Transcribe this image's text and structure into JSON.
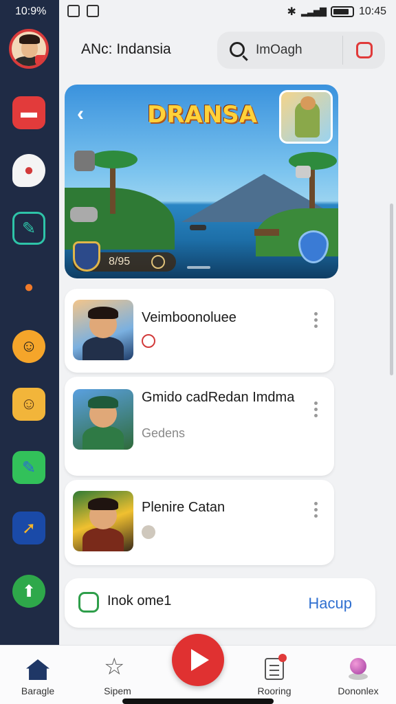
{
  "status_bar": {
    "time_left": "10:9%",
    "time_right": "10:45"
  },
  "header": {
    "title": "ANc: Indansia",
    "search_placeholder": "ImOagh"
  },
  "banner": {
    "title": "DRANSA",
    "pill_value": "8/95"
  },
  "cards": [
    {
      "title": "Veimboonoluee",
      "subtitle": ""
    },
    {
      "title": "Gmido cadRedan Imdma",
      "subtitle": "Gedens"
    },
    {
      "title": "Plenire Catan",
      "subtitle": ""
    }
  ],
  "ad": {
    "text": "Inok ome1",
    "cta": "Hacup"
  },
  "bottom_nav": {
    "items": [
      {
        "label": "Baragle",
        "icon": "home-icon"
      },
      {
        "label": "Sipem",
        "icon": "star-icon"
      },
      {
        "label": "Rooring",
        "icon": "document-icon"
      },
      {
        "label": "Dononlex",
        "icon": "orb-icon"
      }
    ]
  },
  "colors": {
    "rail": "#1f2b45",
    "accent_red": "#e03131",
    "link_blue": "#2f6fd0"
  }
}
